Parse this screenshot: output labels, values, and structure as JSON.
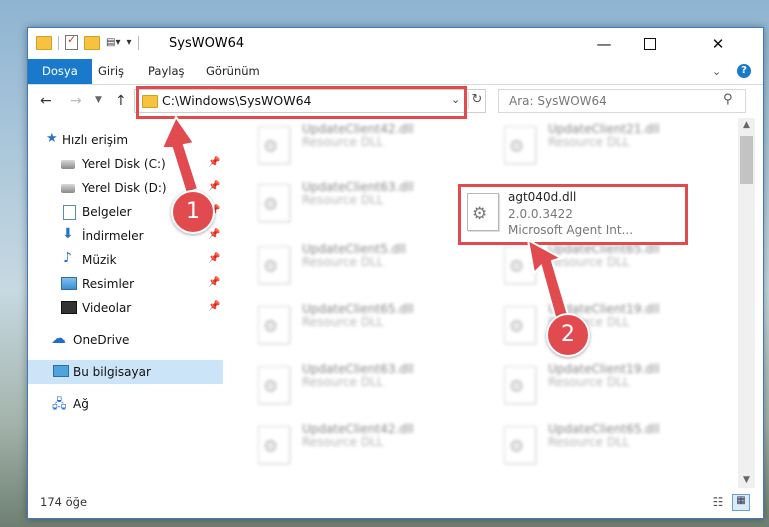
{
  "window": {
    "title": "SysWOW64",
    "minimize_glyph": "—",
    "close_glyph": "✕"
  },
  "ribbon": {
    "tabs": [
      {
        "label": "Dosya",
        "active": true
      },
      {
        "label": "Giriş"
      },
      {
        "label": "Paylaş"
      },
      {
        "label": "Görünüm"
      }
    ],
    "help_glyph": "?"
  },
  "navigation": {
    "address": "C:\\Windows\\SysWOW64",
    "search_placeholder": "Ara: SysWOW64"
  },
  "sidebar": {
    "items": [
      {
        "label": "Hızlı erişim",
        "icon": "star-icon"
      },
      {
        "label": "Yerel Disk (C:)",
        "icon": "drive-icon",
        "pinned": true
      },
      {
        "label": "Yerel Disk (D:)",
        "icon": "drive-icon",
        "pinned": true
      },
      {
        "label": "Belgeler",
        "icon": "documents-icon",
        "pinned": true
      },
      {
        "label": "İndirmeler",
        "icon": "downloads-icon",
        "pinned": true
      },
      {
        "label": "Müzik",
        "icon": "music-icon",
        "pinned": true
      },
      {
        "label": "Resimler",
        "icon": "pictures-icon",
        "pinned": true
      },
      {
        "label": "Videolar",
        "icon": "videos-icon",
        "pinned": true
      },
      {
        "label": "OneDrive",
        "icon": "onedrive-icon"
      },
      {
        "label": "Bu bilgisayar",
        "icon": "computer-icon",
        "selected": true
      },
      {
        "label": "Ağ",
        "icon": "network-icon"
      }
    ]
  },
  "files": {
    "left_column": [
      {
        "name": "UpdateClient42.dll",
        "desc": "Resource DLL"
      },
      {
        "name": "UpdateClient63.dll",
        "desc": "Resource DLL"
      },
      {
        "name": "UpdateClient5.dll",
        "desc": "Resource DLL"
      },
      {
        "name": "UpdateClient65.dll",
        "desc": "Resource DLL"
      },
      {
        "name": "UpdateClient63.dll",
        "desc": "Resource DLL"
      },
      {
        "name": "UpdateClient42.dll",
        "desc": "Resource DLL"
      }
    ],
    "right_column": [
      {
        "name": "UpdateClient21.dll",
        "desc": "Resource DLL"
      },
      {
        "name": "UpdateClient65.dll",
        "desc": "Resource DLL"
      },
      {
        "name": "UpdateClient19.dll",
        "desc": "Resource DLL"
      },
      {
        "name": "UpdateClient19.dll",
        "desc": "Resource DLL"
      },
      {
        "name": "UpdateClient65.dll",
        "desc": "Resource DLL"
      }
    ],
    "highlighted": {
      "name": "agt040d.dll",
      "version": "2.0.0.3422",
      "desc": "Microsoft Agent Int..."
    }
  },
  "status": {
    "count": "174 öğe"
  },
  "callouts": {
    "step1": "1",
    "step2": "2",
    "color": "#e14b4f"
  }
}
